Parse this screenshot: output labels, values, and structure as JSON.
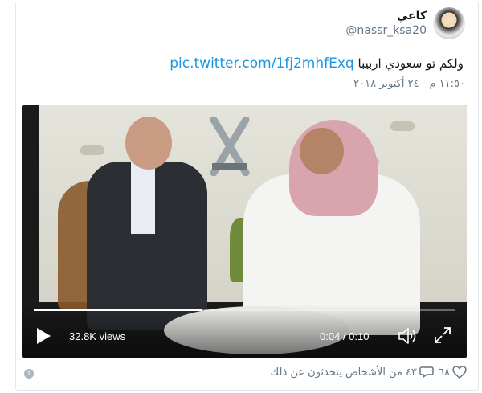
{
  "tweet": {
    "display_name": "كاعي",
    "handle": "@nassr_ksa20",
    "text": "ولكم تو سعودي اربيبا",
    "link": "pic.twitter.com/1fj2mhfExq",
    "timestamp": "١١:٥٠ م - ٢٤ أكتوبر ٢٠١٨"
  },
  "video": {
    "views": "32.8K views",
    "time": "0:04 / 0:10",
    "progress": 0.4,
    "icons": {
      "play": "play-icon",
      "volume": "volume-icon",
      "fullscreen": "fullscreen-icon"
    }
  },
  "footer": {
    "likes": "٦٨",
    "conversation": "٤٣ من الأشخاص يتحدثون عن ذلك",
    "icons": {
      "info": "info-icon",
      "like": "heart-icon",
      "reply": "reply-icon"
    }
  },
  "colors": {
    "link": "#1b95e0",
    "secondary_text": "#657786",
    "border": "#e1e8ed"
  }
}
